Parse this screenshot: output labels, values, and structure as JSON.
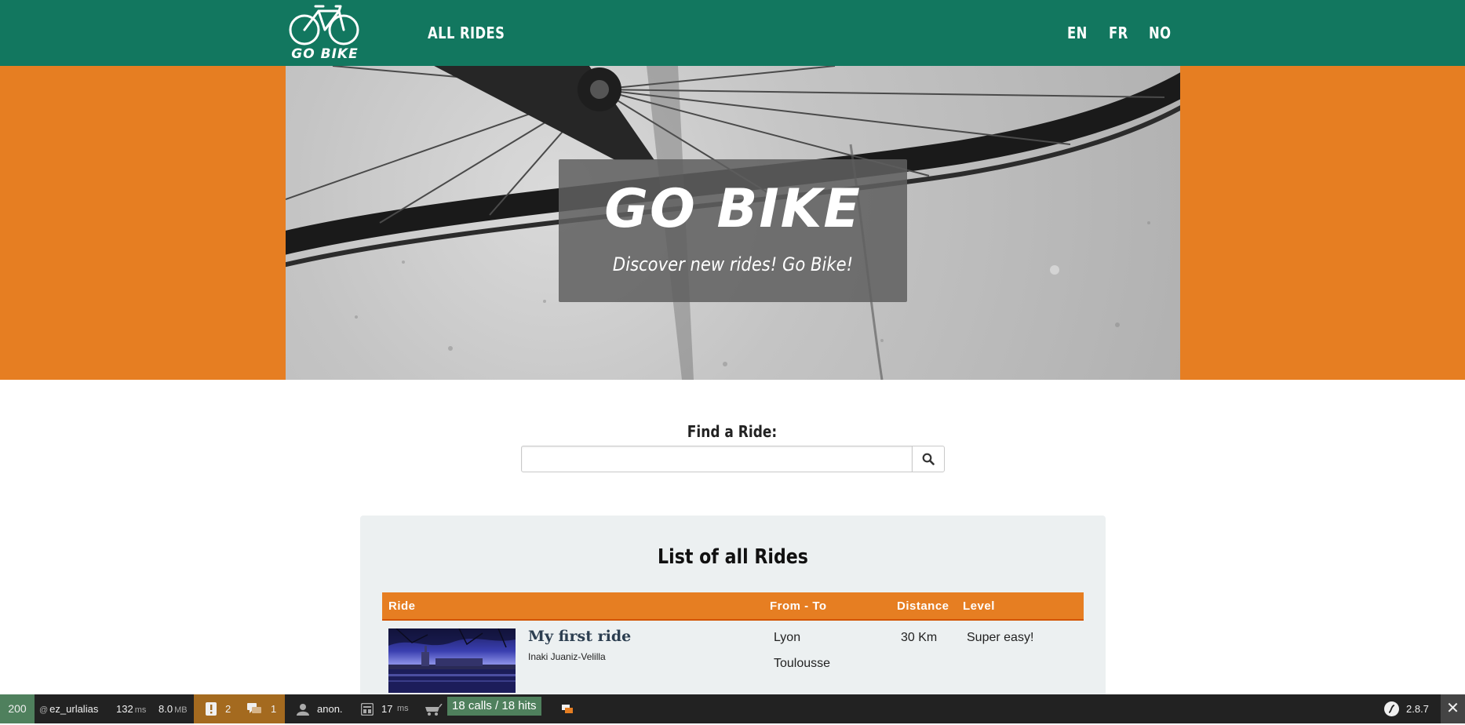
{
  "navbar": {
    "logo_text": "GO BIKE",
    "links": {
      "all_rides": "ALL RIDES",
      "en": "EN",
      "fr": "FR",
      "no": "NO"
    }
  },
  "hero": {
    "title": "GO BIKE",
    "subtitle": "Discover new rides! Go Bike!"
  },
  "search": {
    "label": "Find a Ride:",
    "value": "",
    "button_icon": "search-icon"
  },
  "rides": {
    "title": "List of all Rides",
    "columns": [
      "Ride",
      "From - To",
      "Distance",
      "Level"
    ],
    "rows": [
      {
        "title": "My first ride",
        "author": "Inaki Juaniz-Velilla",
        "from": "Lyon",
        "to": "Toulousse",
        "distance": "30 Km",
        "level": "Super easy!"
      }
    ]
  },
  "toolbar": {
    "status": "200",
    "route_prefix": "@",
    "route": "ez_urlalias",
    "time": "132",
    "time_unit": "ms",
    "memory": "8.0",
    "memory_unit": "MB",
    "warnings": "2",
    "messages": "1",
    "user": "anon.",
    "template_time": "17",
    "template_unit": "ms",
    "cache_calls": "18 calls / 18 hits",
    "version": "2.8.7",
    "close_icon": "close-icon"
  },
  "colors": {
    "navbar": "#12775f",
    "accent_orange": "#e67e22",
    "panel_bg": "#ecf0f1",
    "toolbar_bg": "#222222",
    "toolbar_ok": "#4f805d",
    "toolbar_warn": "#a46a1f"
  }
}
